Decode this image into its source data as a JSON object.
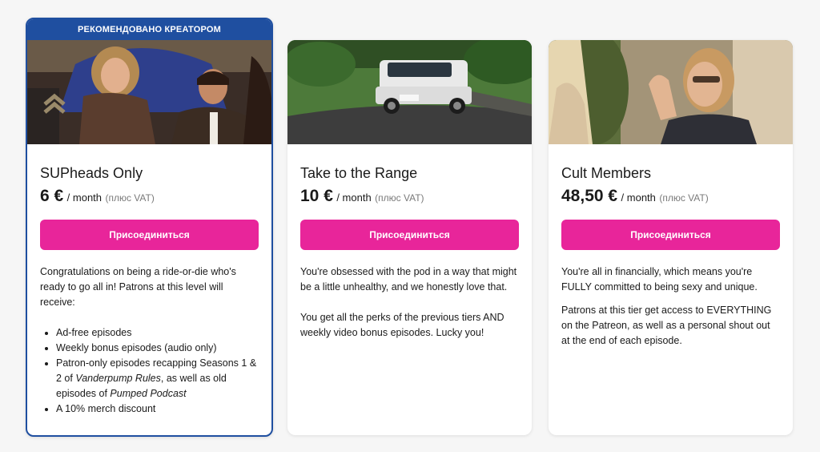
{
  "tiers": [
    {
      "banner": "РЕКОМЕНДОВАНО КРЕАТОРОМ",
      "name": "SUPheads Only",
      "price": "6 €",
      "period": "/ month",
      "vat": "(плюс VAT)",
      "button": "Присоединиться",
      "intro": "Congratulations on being a ride-or-die who's ready to go all in! Patrons at this level will receive:",
      "perks": {
        "p1": "Ad-free episodes",
        "p2": "Weekly bonus episodes (audio only)",
        "p3_a": "Patron-only episodes recapping Seasons 1 & 2 of ",
        "p3_b": "Vanderpump Rules",
        "p3_c": ", as well as old episodes of ",
        "p3_d": "Pumped Podcast",
        "p4": "A 10% merch discount"
      },
      "image": "scene-couch-party"
    },
    {
      "name": "Take to the Range",
      "price": "10 €",
      "period": "/ month",
      "vat": "(плюс VAT)",
      "button": "Присоединиться",
      "para1": "You're obsessed with the pod in a way that might be a little unhealthy, and we honestly love that.",
      "para2": "You get all the perks of the previous tiers AND weekly video bonus episodes. Lucky you!",
      "image": "scene-white-suv"
    },
    {
      "name": "Cult Members",
      "price": "48,50 €",
      "period": "/ month",
      "vat": "(плюс VAT)",
      "button": "Присоединиться",
      "para1": "You're all in financially, which means you're FULLY committed to being sexy and unique.",
      "para2": "Patrons at this tier get access to EVERYTHING on the Patreon, as well as a personal shout out at the end of each episode.",
      "image": "scene-women-outdoors"
    }
  ],
  "colors": {
    "accent_button": "#e8259a",
    "featured_border": "#1f4fa0"
  }
}
